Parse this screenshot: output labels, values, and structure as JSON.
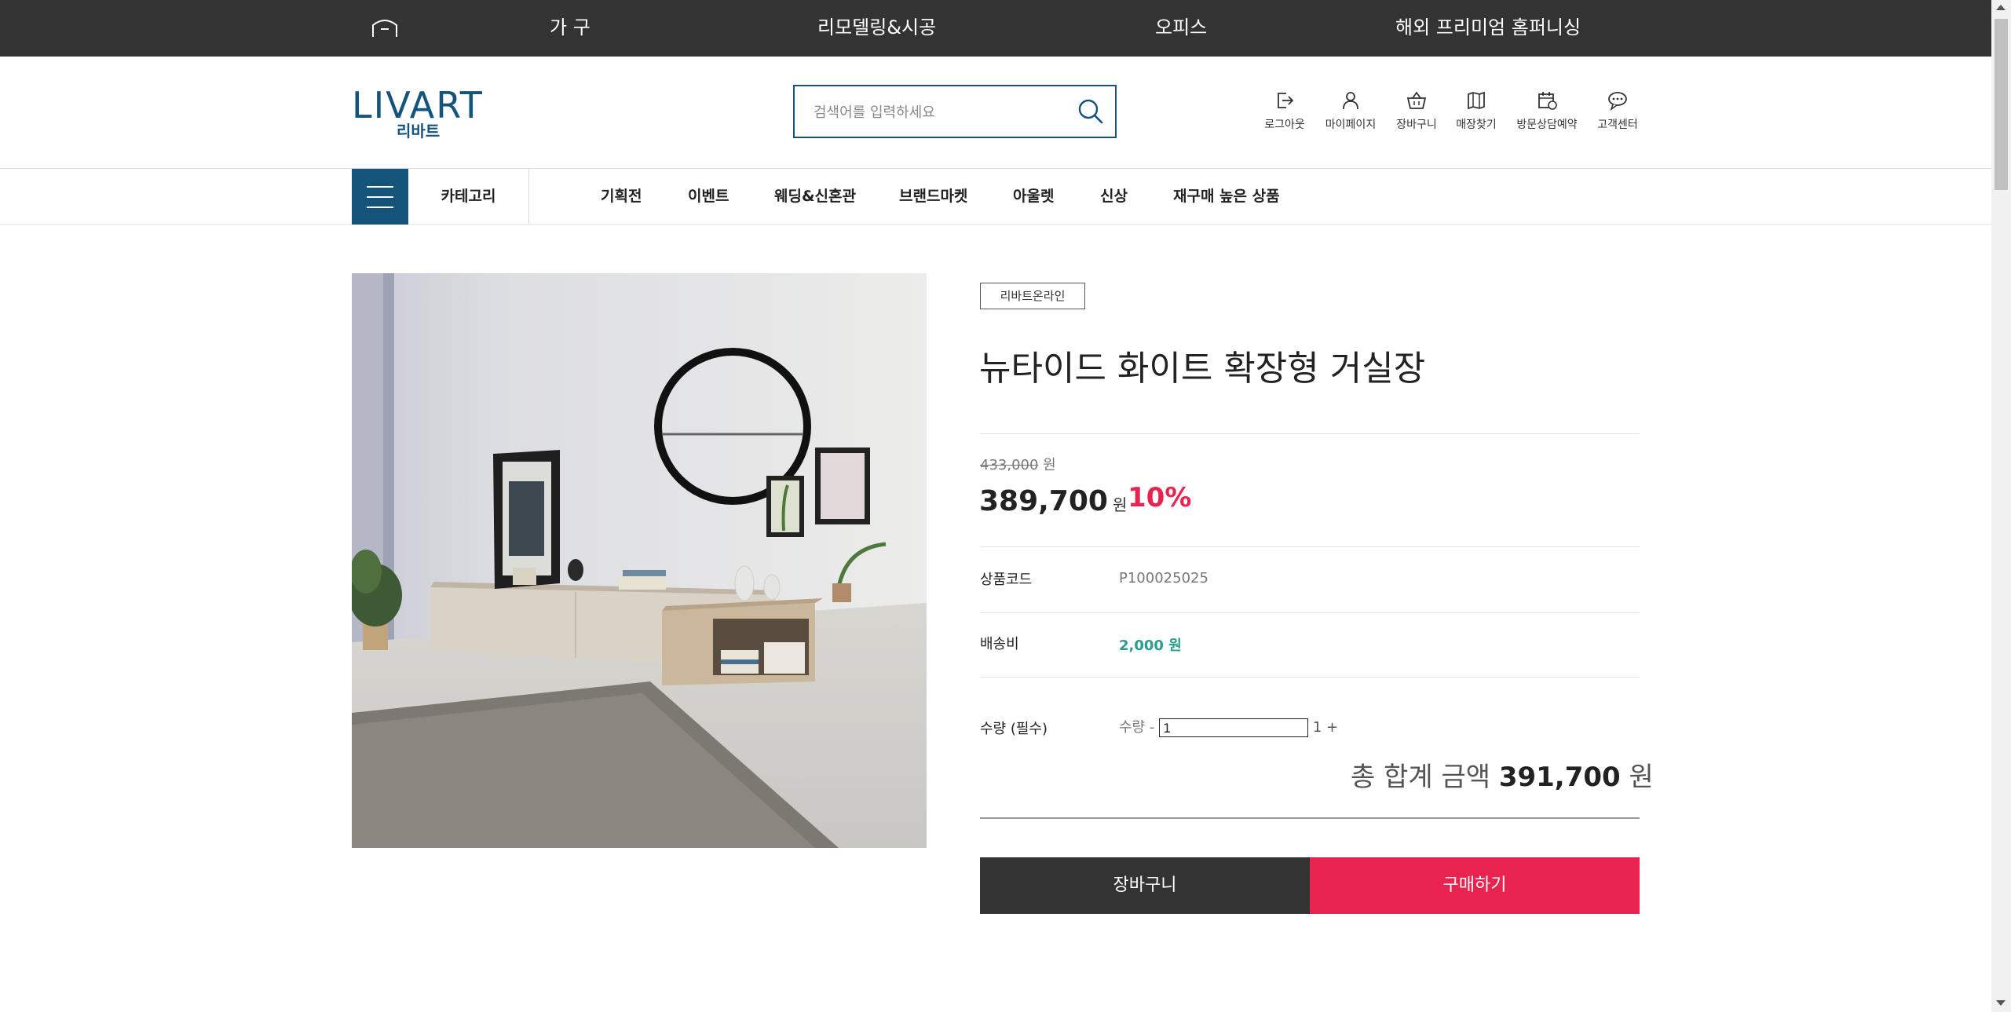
{
  "topnav": {
    "items": [
      "가 구",
      "리모델링&시공",
      "오피스",
      "해외 프리미엄 홈퍼니싱"
    ]
  },
  "header": {
    "logo_text": "LIVART",
    "logo_sub": "리바트",
    "search_placeholder": "검색어를 입력하세요",
    "utils": [
      {
        "label": "로그아웃",
        "icon": "logout-icon"
      },
      {
        "label": "마이페이지",
        "icon": "user-icon"
      },
      {
        "label": "장바구니",
        "icon": "basket-icon"
      },
      {
        "label": "매장찾기",
        "icon": "map-icon"
      },
      {
        "label": "방문상담예약",
        "icon": "calendar-icon"
      },
      {
        "label": "고객센터",
        "icon": "chat-icon"
      }
    ]
  },
  "catbar": {
    "category_label": "카테고리",
    "items": [
      "기획전",
      "이벤트",
      "웨딩&신혼관",
      "브랜드마켓",
      "아울렛",
      "신상",
      "재구매 높은 상품"
    ]
  },
  "product": {
    "badge": "리바트온라인",
    "title": "뉴타이드 화이트 확장형 거실장",
    "original_price": "433,000",
    "original_unit": "원",
    "price": "389,700",
    "price_unit": "원",
    "discount": "10%",
    "code_label": "상품코드",
    "code_value": "P100025025",
    "shipping_label": "배송비",
    "shipping_value": "2,000 원",
    "qty_label": "수량 (필수)",
    "qty_prefix": "수량 -",
    "qty_value": "1",
    "qty_suffix": "1 +",
    "total_label": "총 합계 금액",
    "total_value": "391,700",
    "total_unit": "원",
    "cart_button": "장바구니",
    "buy_button": "구매하기"
  },
  "colors": {
    "brand": "#14537a",
    "accent": "#e8234f",
    "dark": "#333333",
    "shipping": "#2a9d8f"
  }
}
